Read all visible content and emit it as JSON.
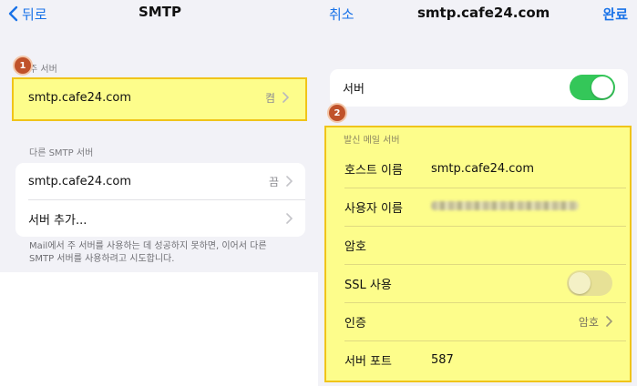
{
  "left": {
    "nav": {
      "back_label": "뒤로",
      "title": "SMTP"
    },
    "primary_section_label": "주 서버",
    "primary_server": {
      "name": "smtp.cafe24.com",
      "status": "켬"
    },
    "other_section_label": "다른 SMTP 서버",
    "other_servers": [
      {
        "name": "smtp.cafe24.com",
        "status": "끔"
      },
      {
        "name": "서버 추가...",
        "status": ""
      }
    ],
    "footer_note": "Mail에서 주 서버를 사용하는 데 성공하지 못하면, 이어서 다른 SMTP 서버를 사용하려고 시도합니다.",
    "badge": "1"
  },
  "right": {
    "nav": {
      "cancel_label": "취소",
      "title": "smtp.cafe24.com",
      "done_label": "완료"
    },
    "server_toggle": {
      "label": "서버",
      "on": true
    },
    "badge": "2",
    "outgoing_section_label": "발신 메일 서버",
    "fields": {
      "host": {
        "label": "호스트 이름",
        "value": "smtp.cafe24.com"
      },
      "username": {
        "label": "사용자 이름",
        "value": "(blurred)"
      },
      "password": {
        "label": "암호",
        "value": ""
      },
      "ssl": {
        "label": "SSL 사용",
        "on": false
      },
      "auth": {
        "label": "인증",
        "value": "암호"
      },
      "port": {
        "label": "서버 포트",
        "value": "587"
      }
    }
  },
  "colors": {
    "accent": "#1a73e8",
    "toggle_on": "#34c759",
    "highlight": "#ffff78",
    "highlight_border": "#f0c419",
    "badge": "#c0522a"
  }
}
